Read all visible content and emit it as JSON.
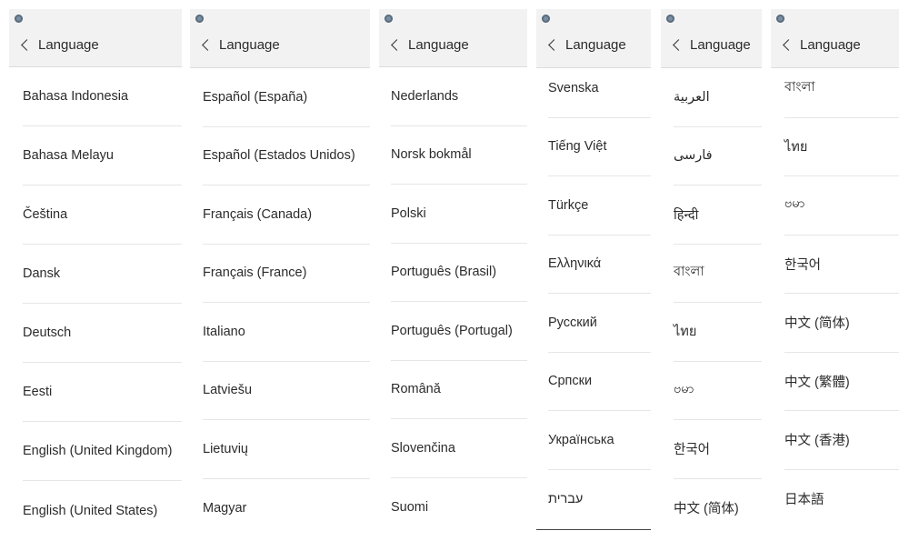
{
  "panels": [
    {
      "header": {
        "title": "Language"
      },
      "items": [
        "Bahasa Indonesia",
        "Bahasa Melayu",
        "Čeština",
        "Dansk",
        "Deutsch",
        "Eesti",
        "English (United Kingdom)",
        "English (United States)"
      ]
    },
    {
      "header": {
        "title": "Language"
      },
      "items": [
        "Español (España)",
        "Español (Estados Unidos)",
        "Français (Canada)",
        "Français (France)",
        "Italiano",
        "Latviešu",
        "Lietuvių",
        "Magyar"
      ]
    },
    {
      "header": {
        "title": "Language"
      },
      "items": [
        "Nederlands",
        "Norsk bokmål",
        "Polski",
        "Português (Brasil)",
        "Português (Portugal)",
        "Română",
        "Slovenčina",
        "Suomi"
      ]
    },
    {
      "header": {
        "title": "Language"
      },
      "items": [
        "Svenska",
        "Tiếng Việt",
        "Türkçe",
        "Ελληνικά",
        "Русский",
        "Српски",
        "Українська",
        "עברית"
      ]
    },
    {
      "header": {
        "title": "Language"
      },
      "items": [
        "العربية",
        "فارسی",
        "हिन्दी",
        "বাংলা",
        "ไทย",
        "ဗမာ",
        "한국어",
        "中文 (简体)"
      ]
    },
    {
      "header": {
        "title": "Language"
      },
      "items": [
        "বাংলা",
        "ไทย",
        "ဗမာ",
        "한국어",
        "中文 (简体)",
        "中文 (繁體)",
        "中文 (香港)",
        "日本語"
      ]
    }
  ],
  "icons": {
    "status": "notification-dot-icon",
    "back": "chevron-left-icon"
  },
  "colors": {
    "header_bg": "#f2f2f2",
    "divider": "#e6e6e6",
    "text": "#2b2b2b"
  }
}
